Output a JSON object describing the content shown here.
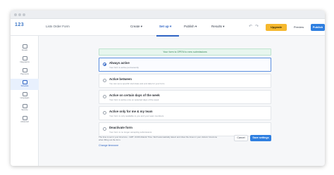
{
  "app": {
    "logo_text": "123",
    "form_title": "Lists Order Form"
  },
  "nav": {
    "items": [
      {
        "label": "Create ▾"
      },
      {
        "label": "Set up ▾"
      },
      {
        "label": "Publish ▾"
      },
      {
        "label": "Results ▾"
      }
    ],
    "undo_label": "↶",
    "redo_label": "↷",
    "upgrade_label": "Upgrade",
    "preview_label": "Preview",
    "publish_label": "Publish"
  },
  "sidebar": {
    "items": [
      {
        "label": "Emails"
      },
      {
        "label": "Integrations"
      },
      {
        "label": "Payments"
      },
      {
        "label": "Schedule"
      },
      {
        "label": "Languages"
      },
      {
        "label": "Security"
      },
      {
        "label": "Advanced"
      }
    ]
  },
  "main": {
    "banner_text": "Your form is OPEN to new submissions",
    "options": [
      {
        "title": "Always active",
        "desc": "Your form is active permanently"
      },
      {
        "title": "Active between",
        "desc": "You can set a specific start date and end date for your form"
      },
      {
        "title": "Active on certain days of the week",
        "desc": "Your form is active only on selected days of the week"
      },
      {
        "title": "Active only for me & my team",
        "desc": "Your form is only available to you and your team members"
      },
      {
        "title": "Deactivate form",
        "desc": "Your form is no longer accepting submissions"
      }
    ],
    "footer_note": "The time is set in your timezone - GMT -04:00 Atlantic Time. We'll automatically detect and show the times in your visitors' timezone when filling out the form.",
    "change_timezone_label": "Change timezone",
    "cancel_label": "Cancel",
    "save_label": "Save settings"
  }
}
